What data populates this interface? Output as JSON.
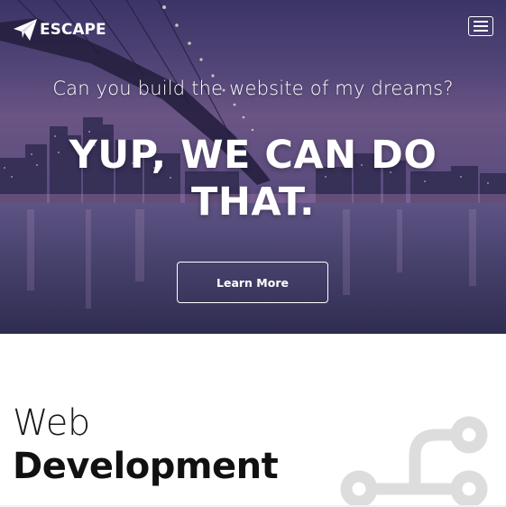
{
  "nav": {
    "brand": "ESCAPE",
    "logo_icon": "paper-plane-icon",
    "menu_icon": "hamburger-icon"
  },
  "hero": {
    "tagline": "Can you build the website of my dreams?",
    "headline": "YUP, WE CAN DO THAT.",
    "cta_label": "Learn More"
  },
  "section": {
    "title_light": "Web",
    "title_bold": "Development",
    "icon": "code-branch-icon"
  },
  "colors": {
    "hero_overlay": "#4b4275",
    "text_on_hero": "#ffffff",
    "section_title": "#111111",
    "icon_gray": "#dcdcdc"
  }
}
